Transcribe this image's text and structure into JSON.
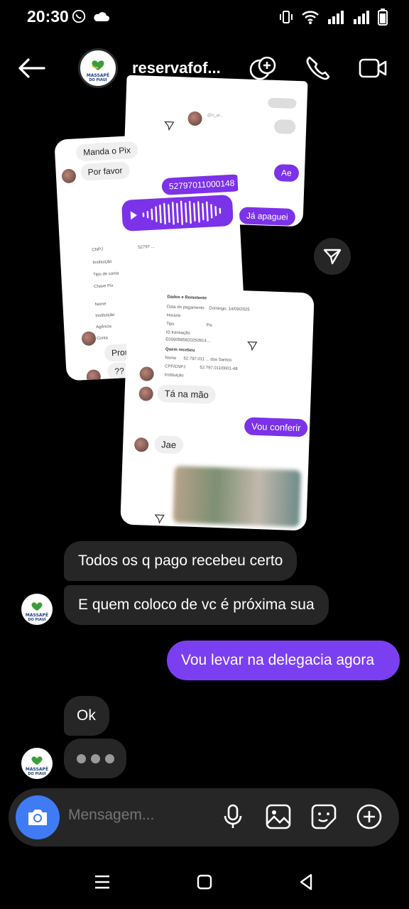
{
  "status_bar": {
    "time": "20:30"
  },
  "header": {
    "title": "reservafof...",
    "back_icon": "arrow-left-icon"
  },
  "brand": {
    "logo_line1": "MASSAPÊ",
    "logo_line2": "DO PIAUÍ",
    "accent": "#7b3ff2",
    "bubble_in": "#262626"
  },
  "collage": {
    "top_shot": {
      "bubble_ae": "Ae",
      "bubble_ja_apaguei": "Já apaguei"
    },
    "left_shot": {
      "manda_pix": "Manda o Pix",
      "por_favor": "Por favor",
      "pix_key": "52797011000148",
      "pronto": "Pronto",
      "question": "??",
      "labels": [
        "CNPJ",
        "Instituição",
        "Tipo de conta",
        "Chave Pix",
        "Nome",
        "Instituição",
        "Agência",
        "Conta"
      ]
    },
    "right_shot": {
      "dados": "Dados e Remetente",
      "quem_recebeu": "Quem recebeu",
      "ta_na_mao": "Tá na mão",
      "vou_conferir": "Vou conferir",
      "jae": "Jae"
    }
  },
  "messages": [
    {
      "from": "them",
      "text": "Todos os q pago recebeu certo"
    },
    {
      "from": "them",
      "text": "E quem coloco de vc é próxima sua"
    },
    {
      "from": "me",
      "text": "Vou levar na delegacia agora"
    },
    {
      "from": "them",
      "text": "Ok"
    }
  ],
  "composer": {
    "placeholder": "Mensagem..."
  }
}
